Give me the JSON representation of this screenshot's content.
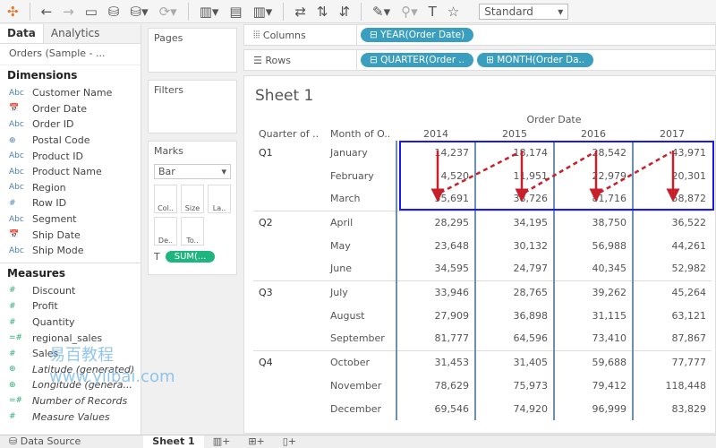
{
  "toolbar": {
    "mode": "Standard"
  },
  "left": {
    "tabs": [
      "Data",
      "Analytics"
    ],
    "source": "Orders (Sample - ...",
    "dimensions_label": "Dimensions",
    "dimensions": [
      {
        "t": "Abc",
        "n": "Customer Name"
      },
      {
        "t": "📅",
        "n": "Order Date"
      },
      {
        "t": "Abc",
        "n": "Order ID"
      },
      {
        "t": "⊕",
        "n": "Postal Code"
      },
      {
        "t": "Abc",
        "n": "Product ID"
      },
      {
        "t": "Abc",
        "n": "Product Name"
      },
      {
        "t": "Abc",
        "n": "Region"
      },
      {
        "t": "#",
        "n": "Row ID"
      },
      {
        "t": "Abc",
        "n": "Segment"
      },
      {
        "t": "📅",
        "n": "Ship Date"
      },
      {
        "t": "Abc",
        "n": "Ship Mode"
      }
    ],
    "measures_label": "Measures",
    "measures": [
      {
        "t": "#",
        "n": "Discount"
      },
      {
        "t": "#",
        "n": "Profit"
      },
      {
        "t": "#",
        "n": "Quantity"
      },
      {
        "t": "=#",
        "n": "regional_sales"
      },
      {
        "t": "#",
        "n": "Sales"
      },
      {
        "t": "⊕",
        "n": "Latitude (generated)",
        "i": true
      },
      {
        "t": "⊕",
        "n": "Longitude (genera...",
        "i": true
      },
      {
        "t": "=#",
        "n": "Number of Records",
        "i": true
      },
      {
        "t": "#",
        "n": "Measure Values",
        "i": true
      }
    ]
  },
  "cards": {
    "pages": "Pages",
    "filters": "Filters",
    "marks": "Marks",
    "mark_type": "Bar",
    "buttons": [
      "Col..",
      "Size",
      "La..",
      "De..",
      "To.."
    ],
    "pill": "SUM(..."
  },
  "shelves": {
    "columns_label": "Columns",
    "columns": [
      "YEAR(Order Date)"
    ],
    "rows_label": "Rows",
    "rows": [
      "QUARTER(Order ..",
      "MONTH(Order Da.."
    ]
  },
  "sheet": {
    "title": "Sheet 1",
    "col_group": "Order Date",
    "row_headers": [
      "Quarter of ..",
      "Month of O.."
    ],
    "years": [
      "2014",
      "2015",
      "2016",
      "2017"
    ],
    "rows": [
      {
        "q": "Q1",
        "m": "January",
        "v": [
          "14,237",
          "18,174",
          "28,542",
          "43,971"
        ]
      },
      {
        "q": "",
        "m": "February",
        "v": [
          "4,520",
          "11,951",
          "22,979",
          "20,301"
        ]
      },
      {
        "q": "",
        "m": "March",
        "v": [
          "55,691",
          "38,726",
          "81,716",
          "58,872"
        ]
      },
      {
        "q": "Q2",
        "m": "April",
        "v": [
          "28,295",
          "34,195",
          "38,750",
          "36,522"
        ]
      },
      {
        "q": "",
        "m": "May",
        "v": [
          "23,648",
          "30,132",
          "56,988",
          "44,261"
        ]
      },
      {
        "q": "",
        "m": "June",
        "v": [
          "34,595",
          "24,797",
          "40,345",
          "52,982"
        ]
      },
      {
        "q": "Q3",
        "m": "July",
        "v": [
          "33,946",
          "28,765",
          "39,262",
          "45,264"
        ]
      },
      {
        "q": "",
        "m": "August",
        "v": [
          "27,909",
          "36,898",
          "31,115",
          "63,121"
        ]
      },
      {
        "q": "",
        "m": "September",
        "v": [
          "81,777",
          "64,596",
          "73,410",
          "87,867"
        ]
      },
      {
        "q": "Q4",
        "m": "October",
        "v": [
          "31,453",
          "31,405",
          "59,688",
          "77,777"
        ]
      },
      {
        "q": "",
        "m": "November",
        "v": [
          "78,629",
          "75,973",
          "79,412",
          "118,448"
        ]
      },
      {
        "q": "",
        "m": "December",
        "v": [
          "69,546",
          "74,920",
          "96,999",
          "83,829"
        ]
      }
    ]
  },
  "bottom": {
    "tabs": [
      "Data Source",
      "Sheet 1"
    ]
  },
  "watermark": "易百教程 www.yiibai.com",
  "colors": {
    "pill": "#3a9fbf",
    "marks_pill": "#1fb57f",
    "highlight": "#1a1aee",
    "arrow": "#c8202a"
  }
}
